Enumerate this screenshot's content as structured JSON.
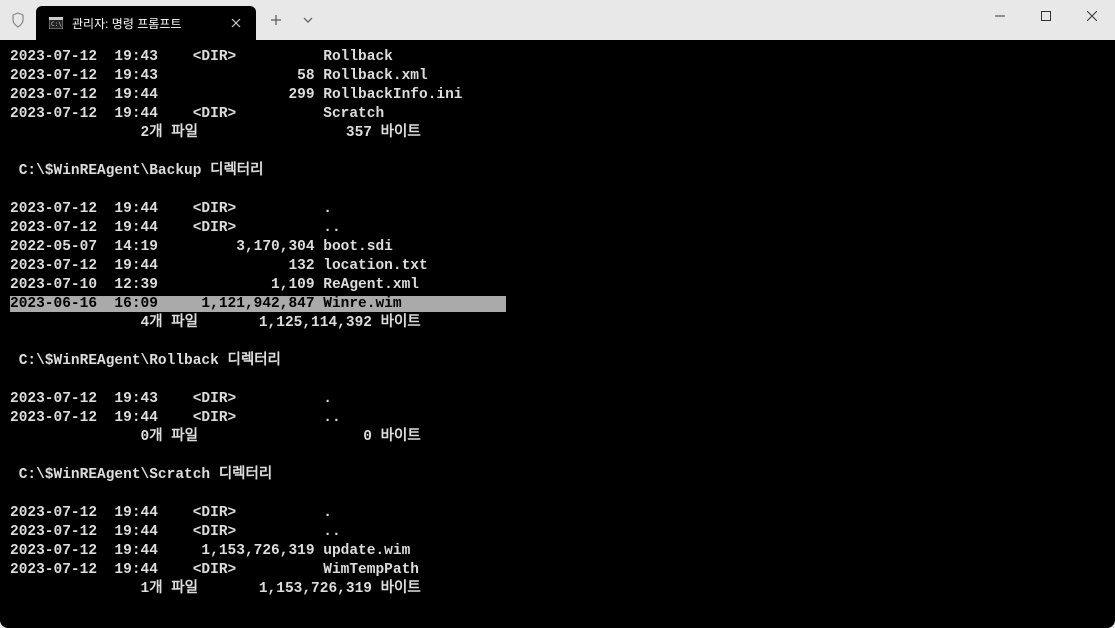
{
  "tab": {
    "title": "관리자: 명령 프롬프트"
  },
  "terminal": {
    "lines": [
      {
        "text": "2023-07-12  19:43    <DIR>          Rollback",
        "highlighted": false
      },
      {
        "text": "2023-07-12  19:43                58 Rollback.xml",
        "highlighted": false
      },
      {
        "text": "2023-07-12  19:44               299 RollbackInfo.ini",
        "highlighted": false
      },
      {
        "text": "2023-07-12  19:44    <DIR>          Scratch",
        "highlighted": false
      },
      {
        "text": "               2개 파일                 357 바이트",
        "highlighted": false
      },
      {
        "text": "",
        "highlighted": false
      },
      {
        "text": " C:\\$WinREAgent\\Backup 디렉터리",
        "highlighted": false
      },
      {
        "text": "",
        "highlighted": false
      },
      {
        "text": "2023-07-12  19:44    <DIR>          .",
        "highlighted": false
      },
      {
        "text": "2023-07-12  19:44    <DIR>          ..",
        "highlighted": false
      },
      {
        "text": "2022-05-07  14:19         3,170,304 boot.sdi",
        "highlighted": false
      },
      {
        "text": "2023-07-12  19:44               132 location.txt",
        "highlighted": false
      },
      {
        "text": "2023-07-10  12:39             1,109 ReAgent.xml",
        "highlighted": false
      },
      {
        "text": "2023-06-16  16:09     1,121,942,847 Winre.wim            ",
        "highlighted": true
      },
      {
        "text": "               4개 파일       1,125,114,392 바이트",
        "highlighted": false
      },
      {
        "text": "",
        "highlighted": false
      },
      {
        "text": " C:\\$WinREAgent\\Rollback 디렉터리",
        "highlighted": false
      },
      {
        "text": "",
        "highlighted": false
      },
      {
        "text": "2023-07-12  19:43    <DIR>          .",
        "highlighted": false
      },
      {
        "text": "2023-07-12  19:44    <DIR>          ..",
        "highlighted": false
      },
      {
        "text": "               0개 파일                   0 바이트",
        "highlighted": false
      },
      {
        "text": "",
        "highlighted": false
      },
      {
        "text": " C:\\$WinREAgent\\Scratch 디렉터리",
        "highlighted": false
      },
      {
        "text": "",
        "highlighted": false
      },
      {
        "text": "2023-07-12  19:44    <DIR>          .",
        "highlighted": false
      },
      {
        "text": "2023-07-12  19:44    <DIR>          ..",
        "highlighted": false
      },
      {
        "text": "2023-07-12  19:44     1,153,726,319 update.wim",
        "highlighted": false
      },
      {
        "text": "2023-07-12  19:44    <DIR>          WimTempPath",
        "highlighted": false
      },
      {
        "text": "               1개 파일       1,153,726,319 바이트",
        "highlighted": false
      }
    ]
  }
}
